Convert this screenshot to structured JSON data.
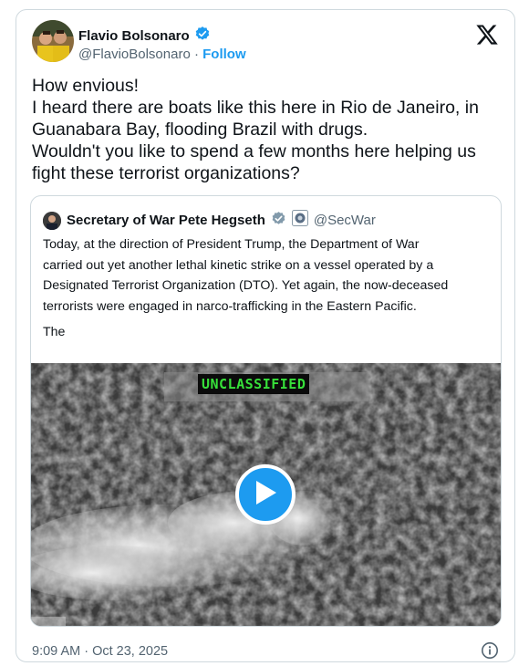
{
  "post": {
    "author_name": "Flavio Bolsonaro",
    "handle": "@FlavioBolsonaro",
    "separator": "·",
    "follow_label": "Follow",
    "text_lines": [
      "How envious!",
      "I heard there are boats like this here in Rio de Janeiro, in",
      "Guanabara Bay, flooding Brazil with drugs.",
      "Wouldn't you like to spend a few months here helping us",
      "fight these terrorist organizations?"
    ],
    "timestamp": "9:09 AM · Oct 23, 2025"
  },
  "quote": {
    "author_name": "Secretary of War Pete Hegseth",
    "handle": "@SecWar",
    "text_lines": [
      "Today, at the direction of President Trump, the Department of War",
      "carried out yet another lethal kinetic strike on a vessel operated by a",
      "Designated Terrorist Organization (DTO). Yet again, the now-deceased",
      "terrorists were engaged in narco-trafficking in the Eastern Pacific."
    ],
    "truncated_text": "The",
    "media_label": "UNCLASSIFIED"
  },
  "icons": {
    "verified": "verified-badge-icon",
    "x_logo": "x-logo-icon",
    "play": "play-icon",
    "info": "info-icon",
    "gov_badge": "government-badge-icon"
  },
  "colors": {
    "accent": "#1d9bf0",
    "text": "#0f1419",
    "secondary": "#536471",
    "border": "#cfd9de",
    "label_green": "#37e03a"
  }
}
